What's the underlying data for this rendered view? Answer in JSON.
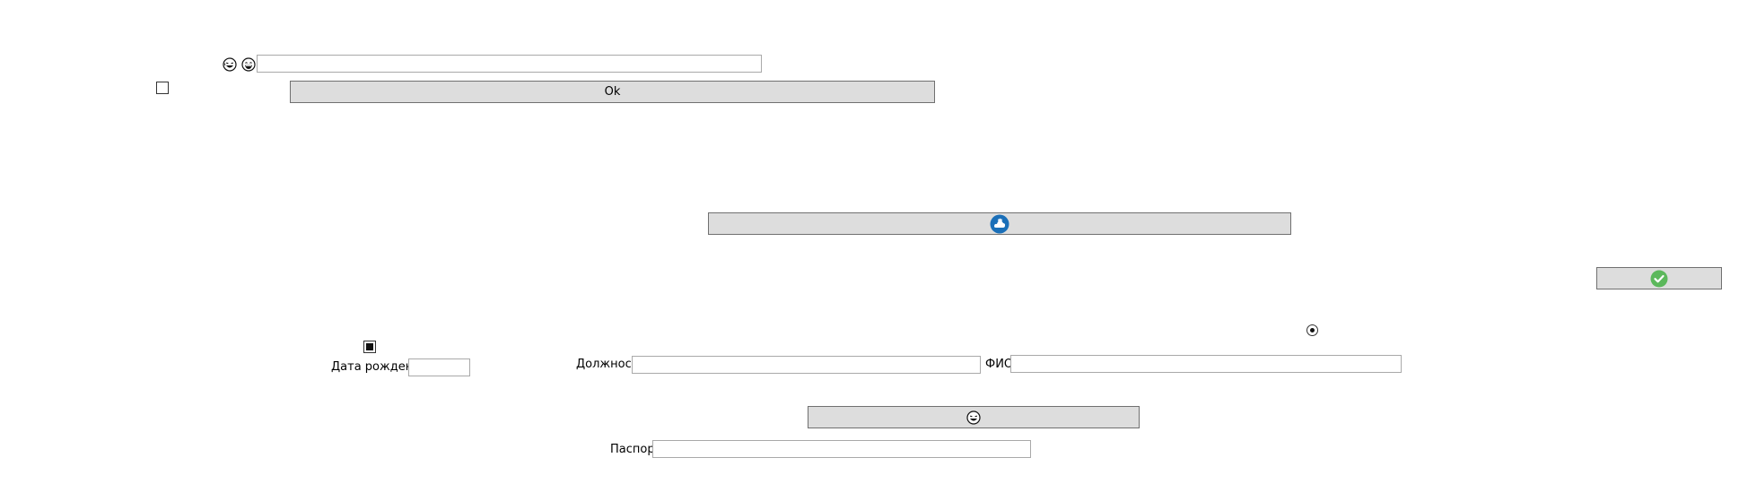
{
  "top_row": {
    "icon1": "laughing-face-icon",
    "icon2": "grinning-face-icon",
    "input_value": ""
  },
  "ok_button": {
    "label": "Ok"
  },
  "cloud_button": {
    "icon": "cloud-hand-icon",
    "accent": "#1a6fb8"
  },
  "check_button": {
    "icon": "checkmark-circle-icon",
    "accent": "#5cb85c"
  },
  "fields": {
    "birth_date_label": "Дата рождения",
    "birth_date_value": "",
    "position_label": "Должность",
    "position_value": "",
    "fio_label": "ФИО",
    "fio_value": "",
    "passport_label": "Паспорт",
    "passport_value": ""
  },
  "smiley_button": {
    "icon": "laughing-face-icon"
  }
}
